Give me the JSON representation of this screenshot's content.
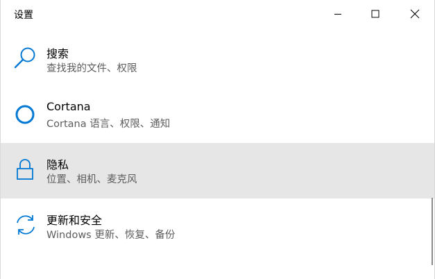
{
  "window": {
    "title": "设置"
  },
  "colors": {
    "accent": "#0078d4",
    "selected_bg": "#e6e6e6",
    "secondary_text": "#5c5c5c"
  },
  "items": [
    {
      "label": "搜索",
      "desc": "查找我的文件、权限",
      "icon": "search-icon"
    },
    {
      "label": "Cortana",
      "desc": "Cortana 语言、权限、通知",
      "icon": "cortana-icon"
    },
    {
      "label": "隐私",
      "desc": "位置、相机、麦克风",
      "icon": "lock-icon",
      "selected": true
    },
    {
      "label": "更新和安全",
      "desc": "Windows 更新、恢复、备份",
      "icon": "sync-icon"
    }
  ]
}
